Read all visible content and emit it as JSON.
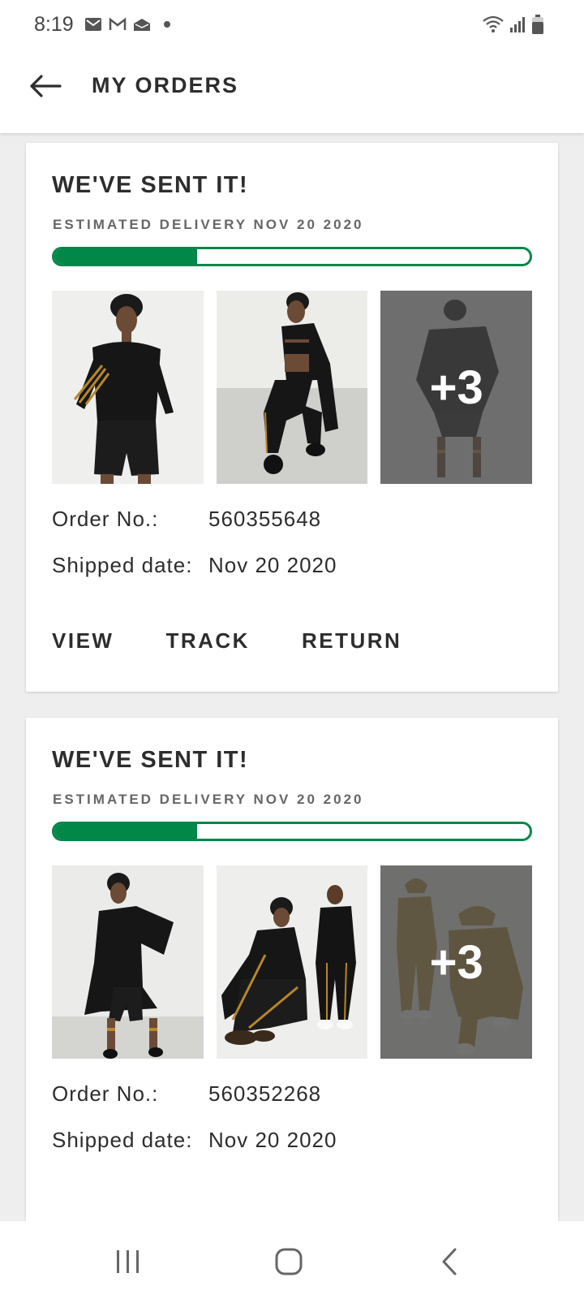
{
  "status_bar": {
    "time": "8:19",
    "left_icons": [
      "mail-icon",
      "gmail-icon",
      "inbox-icon",
      "notification-dot-icon"
    ],
    "right_icons": [
      "wifi-icon",
      "signal-icon",
      "battery-icon"
    ]
  },
  "header": {
    "title": "MY ORDERS",
    "back_icon": "arrow-left-icon"
  },
  "colors": {
    "accent": "#018849",
    "text": "#2d2d2d",
    "muted": "#666666",
    "background": "#eeeeee"
  },
  "orders": [
    {
      "status": "WE'VE SENT IT!",
      "estimated_delivery": "ESTIMATED DELIVERY NOV 20 2020",
      "progress": 0.3,
      "more_items": "+3",
      "order_no_label": "Order No.:",
      "order_no": "560355648",
      "shipped_label": "Shipped date:",
      "shipped_date": "Nov 20 2020",
      "actions": [
        "VIEW",
        "TRACK",
        "RETURN"
      ]
    },
    {
      "status": "WE'VE SENT IT!",
      "estimated_delivery": "ESTIMATED DELIVERY NOV 20 2020",
      "progress": 0.3,
      "more_items": "+3",
      "order_no_label": "Order No.:",
      "order_no": "560352268",
      "shipped_label": "Shipped date:",
      "shipped_date": "Nov 20 2020"
    }
  ],
  "nav_bar": {
    "icons": [
      "recent-apps-icon",
      "home-icon",
      "back-icon"
    ]
  }
}
